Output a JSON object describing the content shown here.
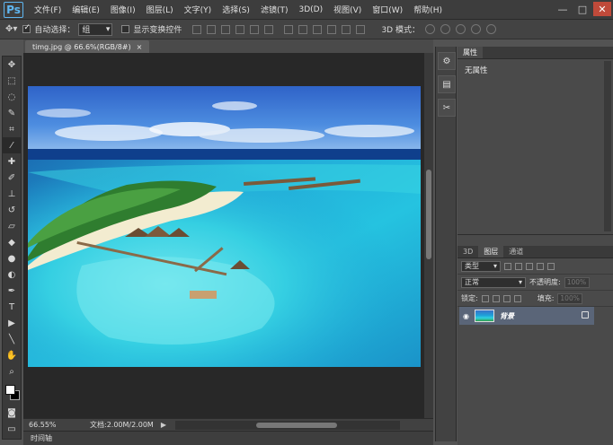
{
  "app": {
    "logo": "Ps",
    "menu": [
      "文件(F)",
      "编辑(E)",
      "图像(I)",
      "图层(L)",
      "文字(Y)",
      "选择(S)",
      "滤镜(T)",
      "3D(D)",
      "视图(V)",
      "窗口(W)",
      "帮助(H)"
    ],
    "window_controls": {
      "minimize": "—",
      "maximize": "□",
      "close": "✕"
    }
  },
  "options": {
    "auto_select_label": "自动选择：",
    "auto_select_value": "组",
    "show_transform_label": "显示变换控件",
    "mode3d_label": "3D 模式："
  },
  "document": {
    "tab_title": "timg.jpg @ 66.6%(RGB/8#)",
    "tab_close": "×",
    "zoom": "66.55%",
    "doc_size": "文档:2.00M/2.00M",
    "timeline": "时间轴"
  },
  "properties_panel": {
    "tab": "属性",
    "message": "无属性"
  },
  "layers_panel": {
    "tabs": [
      "3D",
      "图层",
      "通道"
    ],
    "filter_kind": "类型",
    "blend_mode": "正常",
    "opacity_label": "不透明度:",
    "opacity_value": "100%",
    "lock_label": "锁定:",
    "fill_label": "填充:",
    "fill_value": "100%",
    "layer_name": "背景"
  },
  "colors": {
    "foreground": "#ffffff",
    "background": "#000000",
    "selected_layer": "#5a6578"
  }
}
